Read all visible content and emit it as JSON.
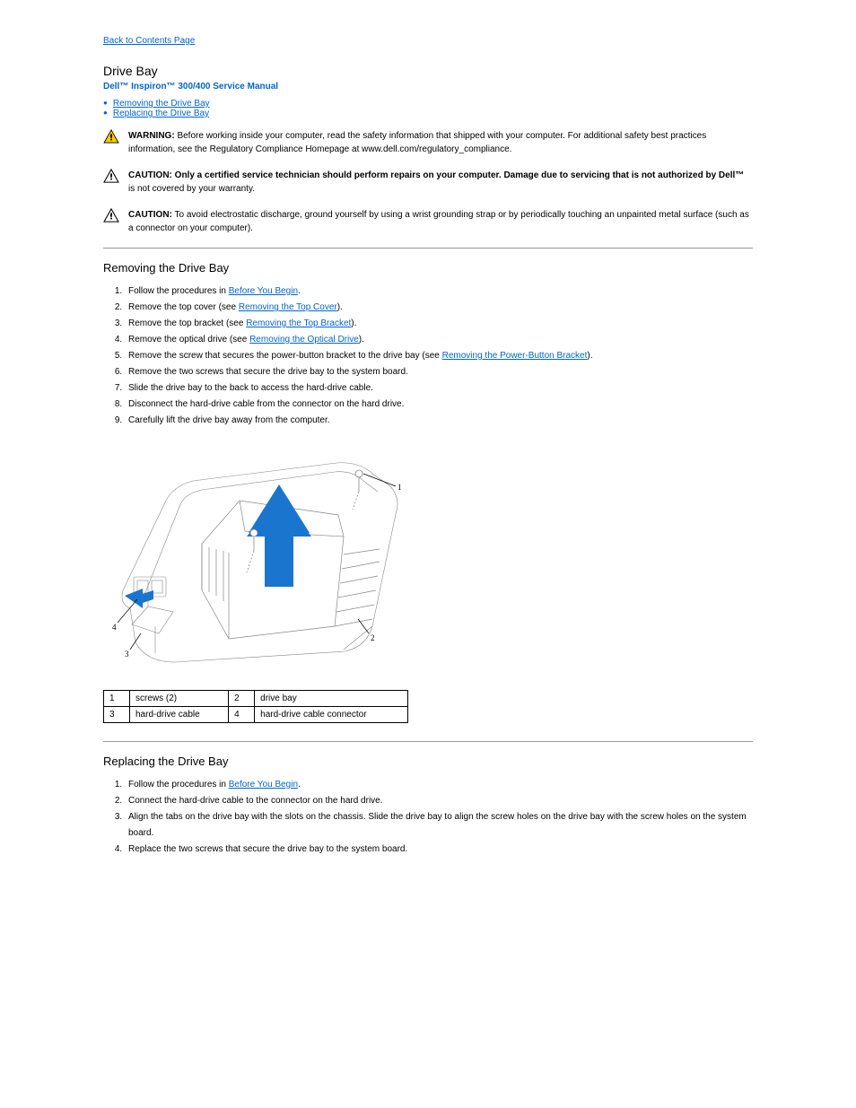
{
  "back_link": "Back to Contents Page",
  "page_title": "Drive Bay",
  "subtitle": "Dell™ Inspiron™ 300/400 Service Manual",
  "toc": [
    "Removing the Drive Bay",
    "Replacing the Drive Bay"
  ],
  "notices": [
    {
      "type": "warning",
      "label": "WARNING:",
      "text": "Before working inside your computer, read the safety information that shipped with your computer. For additional safety best practices information, see the Regulatory Compliance Homepage at www.dell.com/regulatory_compliance."
    },
    {
      "type": "caution",
      "label": "CAUTION:",
      "text_pre": "",
      "bold": "Only a certified service technician should perform repairs on your computer. Damage due to servicing that is not authorized by Dell™",
      "text_post": "is not covered by your warranty."
    },
    {
      "type": "caution",
      "label": "CAUTION:",
      "text": "To avoid electrostatic discharge, ground yourself by using a wrist grounding strap or by periodically touching an unpainted metal surface (such as a connector on your computer)."
    }
  ],
  "removing": {
    "title": "Removing the Drive Bay",
    "steps": [
      {
        "pre": "Follow the procedures in ",
        "link": "Before You Begin",
        "post": "."
      },
      {
        "pre": "Remove the top cover (see ",
        "link": "Removing the Top Cover",
        "post": ")."
      },
      {
        "pre": "Remove the top bracket (see ",
        "link": "Removing the Top Bracket",
        "post": ")."
      },
      {
        "pre": "Remove the optical drive (see ",
        "link": "Removing the Optical Drive",
        "post": ")."
      },
      {
        "pre": "Remove the screw that secures the power-button bracket to the drive bay (see ",
        "link": "Removing the Power-Button Bracket",
        "post": ")."
      },
      {
        "pre": "Remove the two screws that secure the drive bay to the system board.",
        "link": "",
        "post": ""
      },
      {
        "pre": "Slide the drive bay to the back to access the hard-drive cable.",
        "link": "",
        "post": ""
      },
      {
        "pre": "Disconnect the hard-drive cable from the connector on the hard drive.",
        "link": "",
        "post": ""
      },
      {
        "pre": "Carefully lift the drive bay away from the computer.",
        "link": "",
        "post": ""
      }
    ],
    "legend": [
      {
        "num": "1",
        "label": "screws (2)"
      },
      {
        "num": "2",
        "label": "drive bay"
      },
      {
        "num": "3",
        "label": "hard-drive cable"
      },
      {
        "num": "4",
        "label": "hard-drive cable connector"
      }
    ]
  },
  "replacing": {
    "title": "Replacing the Drive Bay",
    "steps": [
      {
        "pre": "Follow the procedures in ",
        "link": "Before You Begin",
        "post": "."
      },
      {
        "pre": "Connect the hard-drive cable to the connector on the hard drive.",
        "link": "",
        "post": ""
      },
      {
        "pre": "Align the tabs on the drive bay with the slots on the chassis. Slide the drive bay to align the screw holes on the drive bay with the screw holes on the system board.",
        "link": "",
        "post": ""
      },
      {
        "pre": "Replace the two screws that secure the drive bay to the system board.",
        "link": "",
        "post": ""
      }
    ]
  }
}
